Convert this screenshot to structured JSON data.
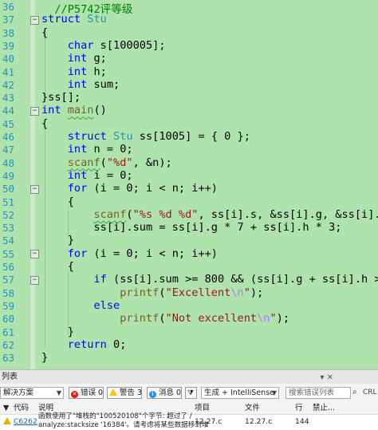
{
  "editor": {
    "line_numbers": [
      "36",
      "37",
      "38",
      "39",
      "40",
      "41",
      "42",
      "43",
      "44",
      "45",
      "46",
      "47",
      "48",
      "49",
      "50",
      "51",
      "52",
      "53",
      "54",
      "55",
      "56",
      "57",
      "58",
      "59",
      "60",
      "61",
      "62",
      "63"
    ]
  },
  "panel": {
    "title": "列表",
    "scope_dropdown": "解决方案",
    "errors_label": "错误 0",
    "warnings_label": "警告 3",
    "messages_label": "消息 0",
    "build_filter": "生成 + IntelliSense",
    "search_placeholder": "搜索错误列表",
    "columns": {
      "code": "代码",
      "desc": "说明",
      "project": "项目",
      "file": "文件",
      "line": "行",
      "suppress": "禁止..."
    },
    "right_edge_text": "CRL",
    "row": {
      "code": "C6262",
      "desc_line1": "函数使用了\"堆栈的\"100520108\"个字节: 超过了 /",
      "desc_line2": "analyze:stacksize '16384'。请考虑将某些数据移到堆",
      "project": "12.27.c",
      "file": "12.27.c",
      "line": "144"
    }
  }
}
